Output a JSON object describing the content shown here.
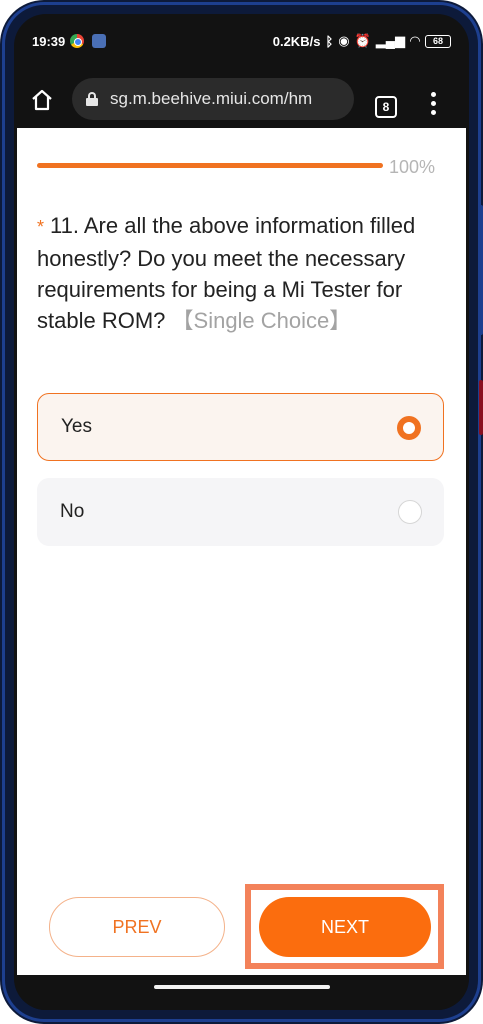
{
  "status_bar": {
    "time": "19:39",
    "net_speed": "0.2KB/s",
    "battery": "68"
  },
  "browser": {
    "url": "sg.m.beehive.miui.com/hm",
    "tab_count": "8"
  },
  "survey": {
    "progress_text": "100%",
    "progress_value": 1.0,
    "required_mark": "*",
    "question_text": "11. Are all the above information filled honestly? Do you meet the necessary requirements for being a Mi Tester for stable ROM?",
    "question_type": "【Single Choice】",
    "options": [
      {
        "label": "Yes",
        "selected": true
      },
      {
        "label": "No",
        "selected": false
      }
    ],
    "prev_label": "PREV",
    "next_label": "NEXT"
  },
  "colors": {
    "accent": "#f07221",
    "next_button": "#fb6d0e",
    "highlight_box": "#f3825a"
  }
}
